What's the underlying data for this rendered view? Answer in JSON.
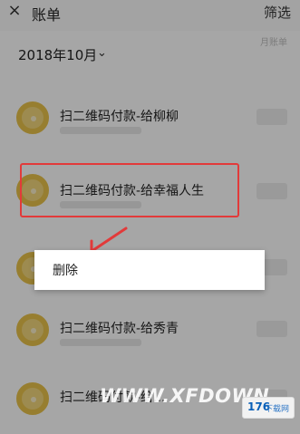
{
  "header": {
    "back_icon": "×",
    "title": "账单",
    "filter_label": "筛选"
  },
  "month": {
    "label": "2018年10月",
    "chevron": "⌄",
    "right_hint": "月账单"
  },
  "items": [
    {
      "name": "扫二维码付款-给柳柳"
    },
    {
      "name": "扫二维码付款-给幸福人生"
    },
    {
      "name": ""
    },
    {
      "name": "扫二维码付款-给秀青"
    },
    {
      "name": "扫二维码付款-给..."
    }
  ],
  "popup": {
    "delete_label": "删除"
  },
  "watermark": {
    "text": "WWW.XFDOWN",
    "logo_text": "176",
    "logo_sub": "下载网"
  },
  "colors": {
    "highlight": "#e23a3a",
    "avatar": "#e9c24a"
  }
}
